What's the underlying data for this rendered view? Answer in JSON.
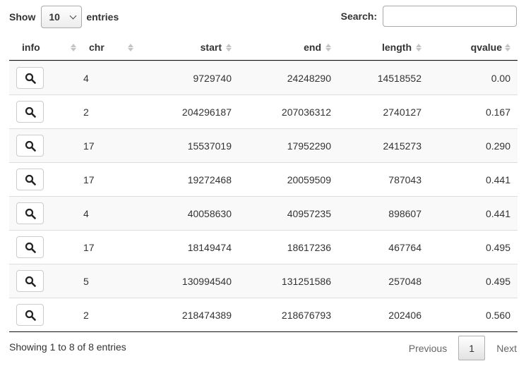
{
  "length_control": {
    "prefix": "Show",
    "selected": "10",
    "suffix": "entries"
  },
  "search": {
    "label": "Search:",
    "value": ""
  },
  "columns": [
    "info",
    "chr",
    "start",
    "end",
    "length",
    "qvalue"
  ],
  "rows": [
    {
      "chr": "4",
      "start": "9729740",
      "end": "24248290",
      "length": "14518552",
      "qvalue": "0.00"
    },
    {
      "chr": "2",
      "start": "204296187",
      "end": "207036312",
      "length": "2740127",
      "qvalue": "0.167"
    },
    {
      "chr": "17",
      "start": "15537019",
      "end": "17952290",
      "length": "2415273",
      "qvalue": "0.290"
    },
    {
      "chr": "17",
      "start": "19272468",
      "end": "20059509",
      "length": "787043",
      "qvalue": "0.441"
    },
    {
      "chr": "4",
      "start": "40058630",
      "end": "40957235",
      "length": "898607",
      "qvalue": "0.441"
    },
    {
      "chr": "17",
      "start": "18149474",
      "end": "18617236",
      "length": "467764",
      "qvalue": "0.495"
    },
    {
      "chr": "5",
      "start": "130994540",
      "end": "131251586",
      "length": "257048",
      "qvalue": "0.495"
    },
    {
      "chr": "2",
      "start": "218474389",
      "end": "218676793",
      "length": "202406",
      "qvalue": "0.560"
    }
  ],
  "row_icon": "search-icon",
  "footer": {
    "info": "Showing 1 to 8 of 8 entries",
    "previous": "Previous",
    "page": "1",
    "next": "Next"
  }
}
